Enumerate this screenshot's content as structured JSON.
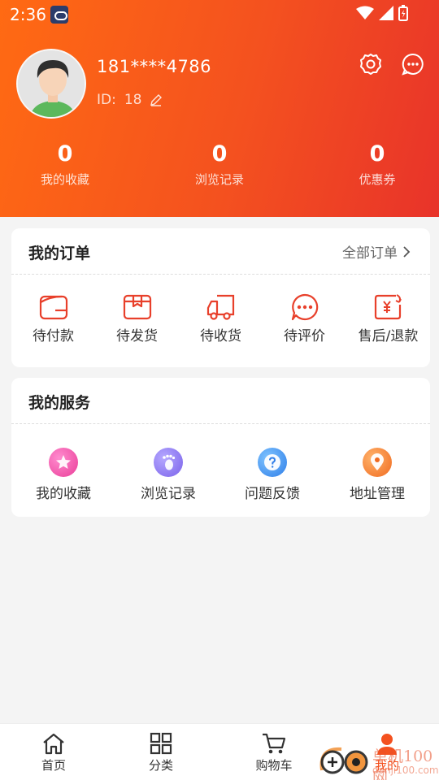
{
  "status_bar": {
    "time": "2:36"
  },
  "profile": {
    "username": "181****4786",
    "id_label": "ID:",
    "id_value": "18"
  },
  "stats": [
    {
      "value": "0",
      "label": "我的收藏"
    },
    {
      "value": "0",
      "label": "浏览记录"
    },
    {
      "value": "0",
      "label": "优惠券"
    }
  ],
  "orders": {
    "title": "我的订单",
    "all_link": "全部订单",
    "items": [
      {
        "label": "待付款",
        "icon": "wallet-icon"
      },
      {
        "label": "待发货",
        "icon": "package-icon"
      },
      {
        "label": "待收货",
        "icon": "truck-icon"
      },
      {
        "label": "待评价",
        "icon": "comment-icon"
      },
      {
        "label": "售后/退款",
        "icon": "refund-icon"
      }
    ]
  },
  "services": {
    "title": "我的服务",
    "items": [
      {
        "label": "我的收藏",
        "icon": "star-icon",
        "color": "#f25aa6"
      },
      {
        "label": "浏览记录",
        "icon": "footprint-icon",
        "color": "#8b7cf0"
      },
      {
        "label": "问题反馈",
        "icon": "question-icon",
        "color": "#3d8ff0"
      },
      {
        "label": "地址管理",
        "icon": "location-icon",
        "color": "#f4792f"
      }
    ]
  },
  "tabbar": {
    "items": [
      {
        "label": "首页",
        "icon": "home-icon"
      },
      {
        "label": "分类",
        "icon": "grid-icon"
      },
      {
        "label": "购物车",
        "icon": "cart-icon"
      },
      {
        "label": "我的",
        "icon": "user-icon"
      }
    ]
  },
  "watermark": {
    "brand": "单机100网",
    "url": "danji100.com"
  },
  "colors": {
    "accent": "#f4511f",
    "header_start": "#ff6a13",
    "header_end": "#e8332a"
  }
}
